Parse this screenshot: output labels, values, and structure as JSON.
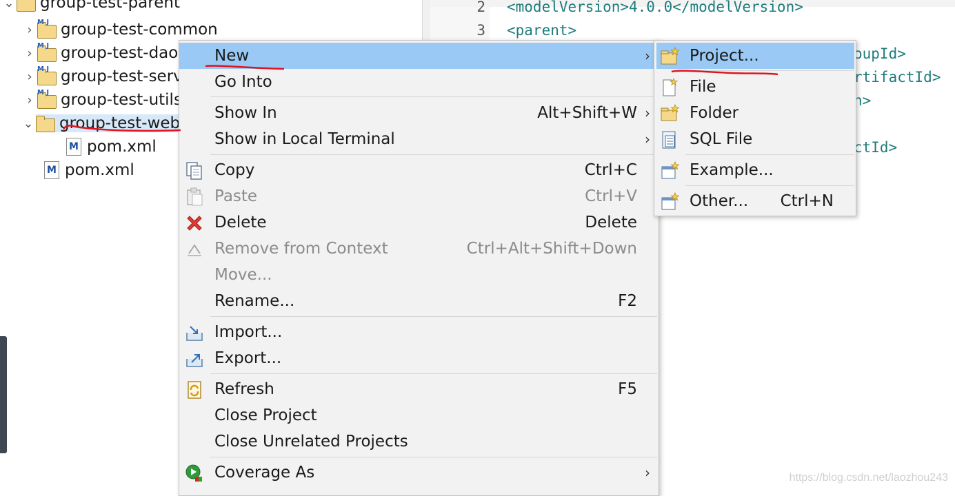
{
  "explorer": {
    "root_label": "group-test-parent",
    "items": [
      {
        "label": "group-test-common",
        "expanded": false
      },
      {
        "label": "group-test-dao",
        "expanded": false
      },
      {
        "label": "group-test-service",
        "expanded": false
      },
      {
        "label": "group-test-utils",
        "expanded": false
      },
      {
        "label": "group-test-web",
        "expanded": true,
        "selected": true
      },
      {
        "label": "pom.xml"
      },
      {
        "label": "pom.xml"
      }
    ]
  },
  "editor": {
    "line_numbers": [
      "2",
      "3"
    ],
    "code_lines": [
      "<modelVersion>4.0.0</modelVersion>",
      "<parent>",
      "oupId>",
      "rtifactId>",
      "n>",
      "ctId>"
    ]
  },
  "context_menu": {
    "items": [
      {
        "label": "New",
        "shortcut": "",
        "submenu": true
      },
      {
        "label": "Go Into",
        "shortcut": ""
      },
      {
        "label": "Show In",
        "shortcut": "Alt+Shift+W",
        "submenu": true
      },
      {
        "label": "Show in Local Terminal",
        "shortcut": "",
        "submenu": true
      },
      {
        "label": "Copy",
        "shortcut": "Ctrl+C"
      },
      {
        "label": "Paste",
        "shortcut": "Ctrl+V",
        "disabled": true
      },
      {
        "label": "Delete",
        "shortcut": "Delete"
      },
      {
        "label": "Remove from Context",
        "shortcut": "Ctrl+Alt+Shift+Down",
        "disabled": true
      },
      {
        "label": "Move...",
        "shortcut": "",
        "disabled": true
      },
      {
        "label": "Rename...",
        "shortcut": "F2"
      },
      {
        "label": "Import...",
        "shortcut": ""
      },
      {
        "label": "Export...",
        "shortcut": ""
      },
      {
        "label": "Refresh",
        "shortcut": "F5"
      },
      {
        "label": "Close Project",
        "shortcut": ""
      },
      {
        "label": "Close Unrelated Projects",
        "shortcut": ""
      },
      {
        "label": "Coverage As",
        "shortcut": "",
        "submenu": true
      }
    ],
    "submenu_arrow": "›"
  },
  "new_submenu": {
    "items": [
      {
        "label": "Project...",
        "shortcut": ""
      },
      {
        "label": "File",
        "shortcut": ""
      },
      {
        "label": "Folder",
        "shortcut": ""
      },
      {
        "label": "SQL File",
        "shortcut": ""
      },
      {
        "label": "Example...",
        "shortcut": ""
      },
      {
        "label": "Other...",
        "shortcut": "Ctrl+N"
      }
    ]
  },
  "watermark": "https://blog.csdn.net/laozhou243",
  "colors": {
    "highlight": "#99c9f4",
    "annotation": "#e0141e",
    "code": "#1e7c7c"
  }
}
